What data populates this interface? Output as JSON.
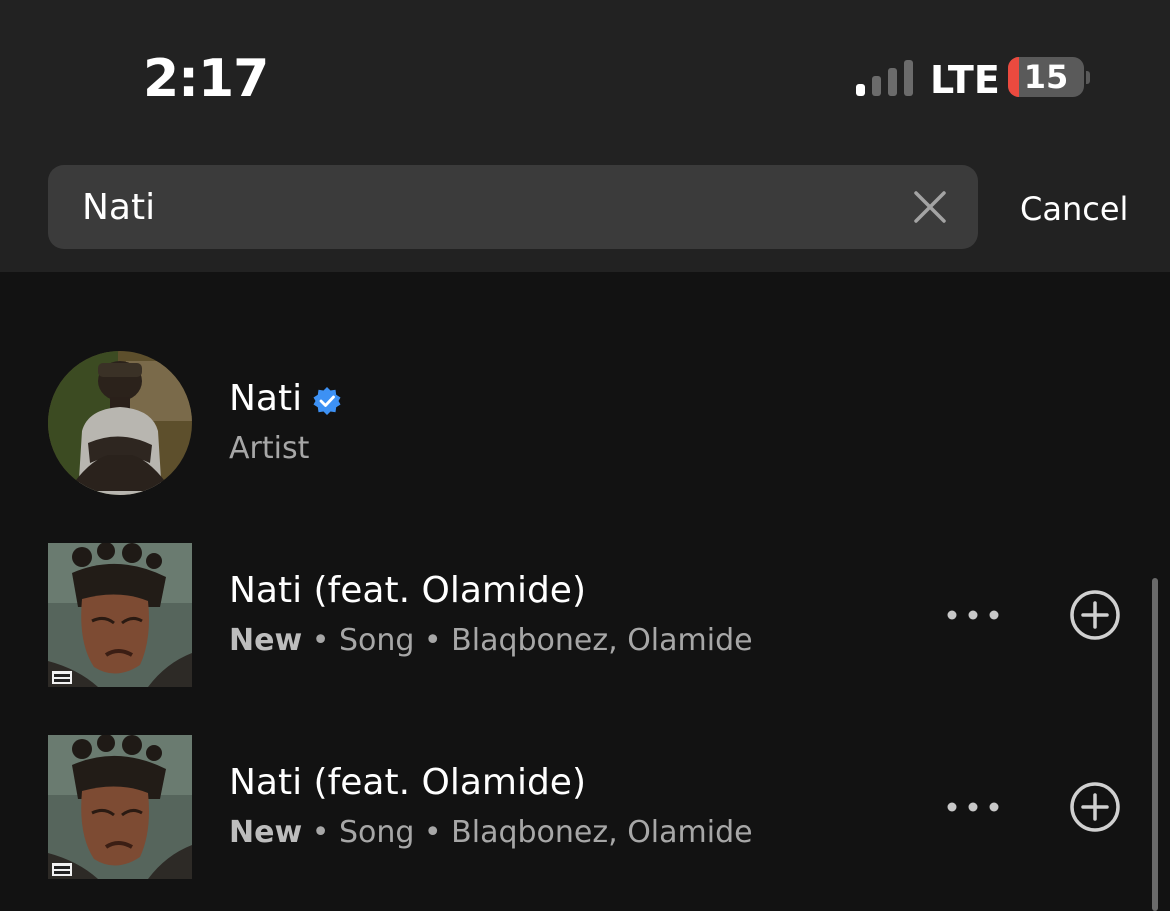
{
  "status_bar": {
    "time": "2:17",
    "network": "LTE",
    "signal_bars_active": 1,
    "battery_percent": "15",
    "battery_level": 0.15
  },
  "search": {
    "query": "Nati",
    "clear_icon": "close-icon",
    "cancel_label": "Cancel"
  },
  "results": [
    {
      "type": "artist",
      "name": "Nati",
      "verified": true,
      "subtitle": "Artist"
    },
    {
      "type": "song",
      "title": "Nati (feat. Olamide)",
      "tag": "New",
      "meta": " • Song • Blaqbonez, Olamide"
    },
    {
      "type": "song",
      "title": "Nati (feat. Olamide)",
      "tag": "New",
      "meta": " • Song • Blaqbonez, Olamide"
    }
  ],
  "colors": {
    "background": "#121212",
    "header": "#222222",
    "search_field": "#3b3b3b",
    "verified_badge": "#3d91f4",
    "battery_low": "#eb4a3f"
  }
}
